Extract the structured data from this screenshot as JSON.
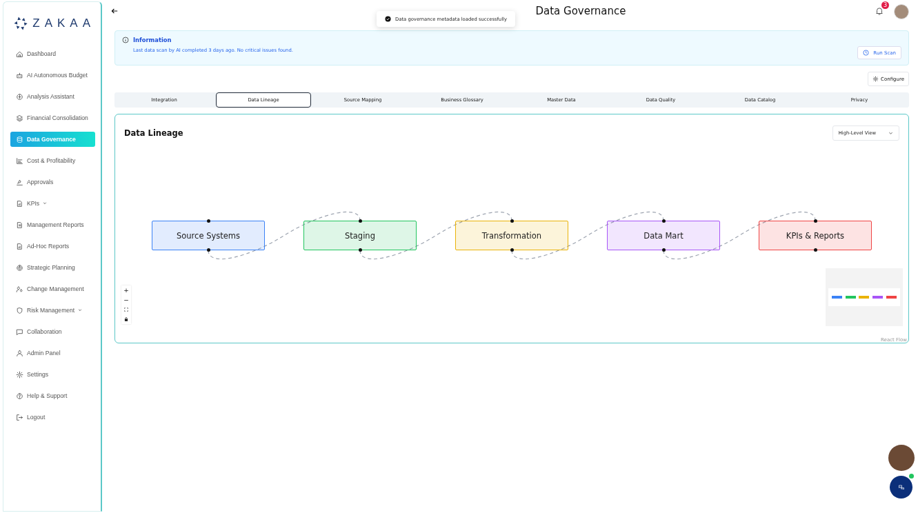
{
  "brand": {
    "name": "ZAKAA"
  },
  "sidebar": {
    "items": [
      {
        "label": "Dashboard",
        "selected": false,
        "submenu": false
      },
      {
        "label": "AI Autonomous Budget",
        "selected": false,
        "submenu": false
      },
      {
        "label": "Analysis Assistant",
        "selected": false,
        "submenu": false
      },
      {
        "label": "Financial Consolidation",
        "selected": false,
        "submenu": false
      },
      {
        "label": "Data Governance",
        "selected": true,
        "submenu": false
      },
      {
        "label": "Cost & Profitability",
        "selected": false,
        "submenu": false
      },
      {
        "label": "Approvals",
        "selected": false,
        "submenu": false
      },
      {
        "label": "KPIs",
        "selected": false,
        "submenu": true
      },
      {
        "label": "Management Reports",
        "selected": false,
        "submenu": false
      },
      {
        "label": "Ad-Hoc Reports",
        "selected": false,
        "submenu": false
      },
      {
        "label": "Strategic Planning",
        "selected": false,
        "submenu": false
      },
      {
        "label": "Change Management",
        "selected": false,
        "submenu": false
      },
      {
        "label": "Risk Management",
        "selected": false,
        "submenu": true
      },
      {
        "label": "Collaboration",
        "selected": false,
        "submenu": false
      },
      {
        "label": "Admin Panel",
        "selected": false,
        "submenu": false
      },
      {
        "label": "Settings",
        "selected": false,
        "submenu": false
      },
      {
        "label": "Help & Support",
        "selected": false,
        "submenu": false
      },
      {
        "label": "Logout",
        "selected": false,
        "submenu": false
      }
    ]
  },
  "header": {
    "title": "Data Governance",
    "notification_count": "3"
  },
  "toast": {
    "message": "Data governance metadata loaded successfully"
  },
  "info": {
    "title": "Information",
    "message": "Last data scan by AI completed 3 days ago. No critical issues found.",
    "button": "Run Scan"
  },
  "configure_button": "Configure",
  "tabs": [
    {
      "label": "Integration",
      "selected": false
    },
    {
      "label": "Data Lineage",
      "selected": true
    },
    {
      "label": "Source Mapping",
      "selected": false
    },
    {
      "label": "Business Glossary",
      "selected": false
    },
    {
      "label": "Master Data",
      "selected": false
    },
    {
      "label": "Data Quality",
      "selected": false
    },
    {
      "label": "Data Catalog",
      "selected": false
    },
    {
      "label": "Privacy",
      "selected": false
    }
  ],
  "lineage": {
    "title": "Data Lineage",
    "view_select": "High-Level View",
    "nodes": [
      {
        "label": "Source Systems",
        "color": "#3b82f6"
      },
      {
        "label": "Staging",
        "color": "#22c55e"
      },
      {
        "label": "Transformation",
        "color": "#eab308"
      },
      {
        "label": "Data Mart",
        "color": "#a855f7"
      },
      {
        "label": "KPIs & Reports",
        "color": "#ef4444"
      }
    ],
    "controls": [
      "+",
      "−"
    ],
    "attribution": "React Flow"
  }
}
